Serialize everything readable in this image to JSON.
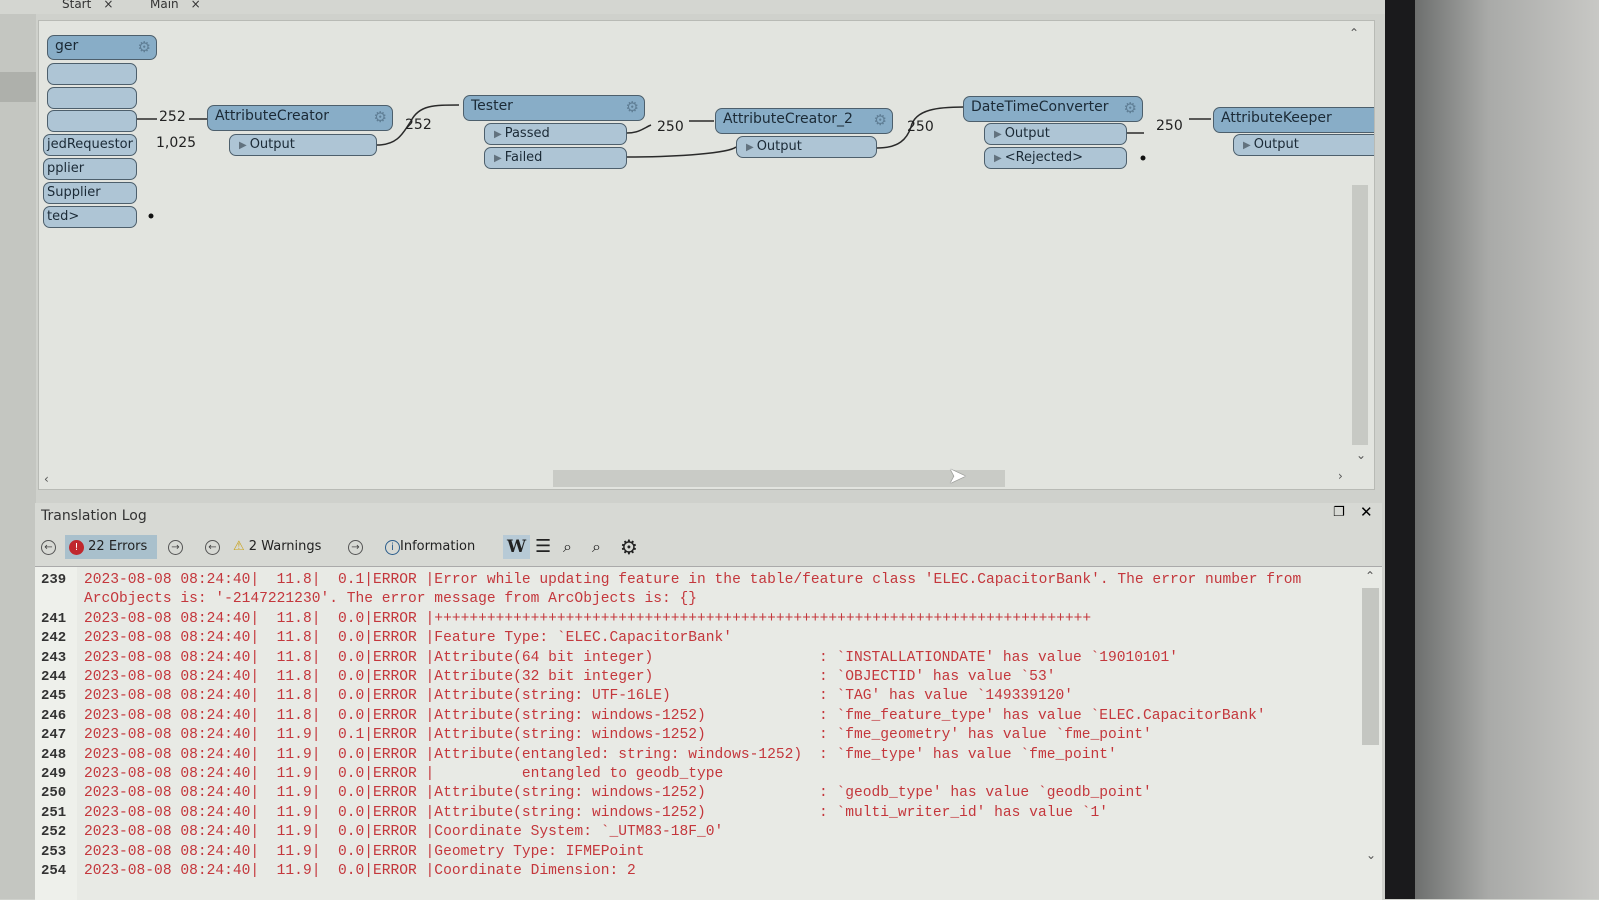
{
  "tabs": [
    {
      "label": "Start",
      "close": "×"
    },
    {
      "label": "Main",
      "close": "×"
    }
  ],
  "canvas": {
    "left_node": {
      "header": "ger",
      "ports": [
        "",
        "",
        "",
        "jedRequestor",
        "pplier",
        "Supplier",
        "ted>"
      ]
    },
    "nodes": [
      {
        "name": "AttributeCreator",
        "ports": [
          "Output"
        ]
      },
      {
        "name": "Tester",
        "ports": [
          "Passed",
          "Failed"
        ]
      },
      {
        "name": "AttributeCreator_2",
        "ports": [
          "Output"
        ]
      },
      {
        "name": "DateTimeConverter",
        "ports": [
          "Output",
          "<Rejected>"
        ]
      },
      {
        "name": "AttributeKeeper",
        "ports": [
          "Output"
        ]
      }
    ],
    "counts": [
      "252",
      "1,025",
      "252",
      "250",
      "250",
      "250"
    ],
    "node_color": "#88adc7",
    "port_color": "#aec5d5"
  },
  "log": {
    "title": "Translation Log",
    "errors": "22 Errors",
    "warnings": "2 Warnings",
    "information": "Information",
    "error_color": "#c4373c",
    "lines": [
      {
        "n": "239",
        "t": "2023-08-08 08:24:40|  11.8|  0.1|ERROR |Error while updating feature in the table/feature class 'ELEC.CapacitorBank'. The error number from",
        "v": ""
      },
      {
        "n": "",
        "t": "ArcObjects is: '-2147221230'. The error message from ArcObjects is: {}",
        "v": ""
      },
      {
        "n": "241",
        "t": "2023-08-08 08:24:40|  11.8|  0.0|ERROR |+++++++++++++++++++++++++++++++++++++++++++++++++++++++++++++++++++++++++++",
        "v": ""
      },
      {
        "n": "242",
        "t": "2023-08-08 08:24:40|  11.8|  0.0|ERROR |Feature Type: `ELEC.CapacitorBank'",
        "v": ""
      },
      {
        "n": "243",
        "t": "2023-08-08 08:24:40|  11.8|  0.0|ERROR |Attribute(64 bit integer)",
        "v": ": `INSTALLATIONDATE' has value `19010101'"
      },
      {
        "n": "244",
        "t": "2023-08-08 08:24:40|  11.8|  0.0|ERROR |Attribute(32 bit integer)",
        "v": ": `OBJECTID' has value `53'"
      },
      {
        "n": "245",
        "t": "2023-08-08 08:24:40|  11.8|  0.0|ERROR |Attribute(string: UTF-16LE)",
        "v": ": `TAG' has value `149339120'"
      },
      {
        "n": "246",
        "t": "2023-08-08 08:24:40|  11.8|  0.0|ERROR |Attribute(string: windows-1252)",
        "v": ": `fme_feature_type' has value `ELEC.CapacitorBank'"
      },
      {
        "n": "247",
        "t": "2023-08-08 08:24:40|  11.9|  0.1|ERROR |Attribute(string: windows-1252)",
        "v": ": `fme_geometry' has value `fme_point'"
      },
      {
        "n": "248",
        "t": "2023-08-08 08:24:40|  11.9|  0.0|ERROR |Attribute(entangled: string: windows-1252)",
        "v": ": `fme_type' has value `fme_point'"
      },
      {
        "n": "249",
        "t": "2023-08-08 08:24:40|  11.9|  0.0|ERROR |          entangled to geodb_type",
        "v": ""
      },
      {
        "n": "250",
        "t": "2023-08-08 08:24:40|  11.9|  0.0|ERROR |Attribute(string: windows-1252)",
        "v": ": `geodb_type' has value `geodb_point'"
      },
      {
        "n": "251",
        "t": "2023-08-08 08:24:40|  11.9|  0.0|ERROR |Attribute(string: windows-1252)",
        "v": ": `multi_writer_id' has value `1'"
      },
      {
        "n": "252",
        "t": "2023-08-08 08:24:40|  11.9|  0.0|ERROR |Coordinate System: `_UTM83-18F_0'",
        "v": ""
      },
      {
        "n": "253",
        "t": "2023-08-08 08:24:40|  11.9|  0.0|ERROR |Geometry Type: IFMEPoint",
        "v": ""
      },
      {
        "n": "254",
        "t": "2023-08-08 08:24:40|  11.9|  0.0|ERROR |Coordinate Dimension: 2",
        "v": ""
      }
    ]
  }
}
